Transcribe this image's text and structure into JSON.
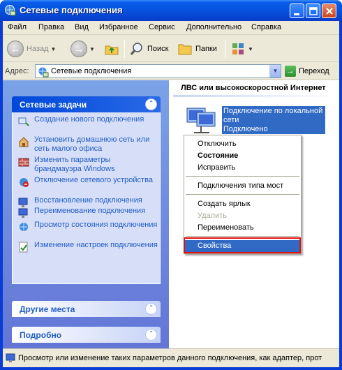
{
  "window": {
    "title": "Сетевые подключения"
  },
  "menu": [
    "Файл",
    "Правка",
    "Вид",
    "Избранное",
    "Сервис",
    "Дополнительно",
    "Справка"
  ],
  "toolbar": {
    "back": "Назад",
    "search": "Поиск",
    "folders": "Папки"
  },
  "address": {
    "label": "Адрес:",
    "value": "Сетевые подключения",
    "go": "Переход"
  },
  "left_panels": {
    "tasks": {
      "title": "Сетевые задачи",
      "items": [
        {
          "label": "Создание нового подключения",
          "icon": "new-connection-icon"
        },
        {
          "label": "Установить домашнюю сеть или сеть малого офиса",
          "icon": "home-network-icon"
        },
        {
          "label": "Изменить параметры брандмауэра Windows",
          "icon": "firewall-icon"
        },
        {
          "label": "Отключение сетевого устройства",
          "icon": "disable-device-icon"
        },
        {
          "label": "Восстановление подключения",
          "icon": "repair-icon"
        },
        {
          "label": "Переименование подключения",
          "icon": "rename-icon"
        },
        {
          "label": "Просмотр состояния подключения",
          "icon": "status-icon"
        },
        {
          "label": "Изменение настроек подключения",
          "icon": "settings-check-icon"
        }
      ]
    },
    "other_places": {
      "title": "Другие места"
    },
    "details": {
      "title": "Подробно"
    }
  },
  "right_pane": {
    "group_header": "ЛВС или высокоскоростной Интернет",
    "connection": {
      "name_line1": "Подключение по локальной",
      "name_line2": "сети",
      "status": "Подключено"
    }
  },
  "context_menu": {
    "items": [
      {
        "label": "Отключить",
        "style": "normal"
      },
      {
        "label": "Состояние",
        "style": "bold"
      },
      {
        "label": "Исправить",
        "style": "normal"
      },
      {
        "label": "Подключения типа мост",
        "style": "normal"
      },
      {
        "label": "Создать ярлык",
        "style": "normal"
      },
      {
        "label": "Удалить",
        "style": "disabled"
      },
      {
        "label": "Переименовать",
        "style": "normal"
      },
      {
        "label": "Свойства",
        "style": "selected"
      }
    ]
  },
  "status_bar": {
    "text": "Просмотр или изменение таких параметров данного подключения, как адаптер, прот"
  },
  "colors": {
    "title_blue": "#0654e0",
    "selection": "#316ac5",
    "highlight_red": "#e01010",
    "link": "#215dc6"
  }
}
